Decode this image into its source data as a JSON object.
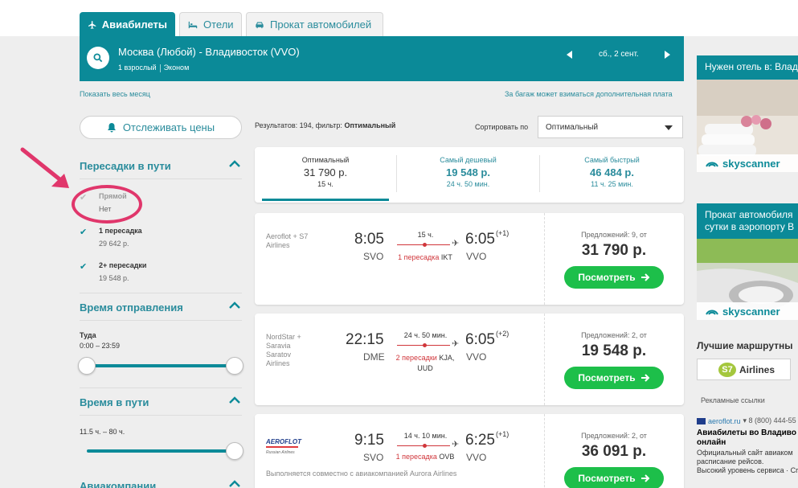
{
  "tabs": [
    {
      "label": "Авиабилеты",
      "icon": "plane-icon",
      "active": true
    },
    {
      "label": "Отели",
      "icon": "bed-icon",
      "active": false
    },
    {
      "label": "Прокат автомобилей",
      "icon": "car-icon",
      "active": false
    }
  ],
  "search": {
    "route": "Москва (Любой) - Владивосток (VVO)",
    "passengers": "1 взрослый",
    "cabin": "Эконом",
    "date": "сб., 2 сент."
  },
  "links": {
    "show_month": "Показать весь месяц",
    "baggage_fee": "За багаж может взиматься дополнительная плата"
  },
  "track_prices": "Отслеживать цены",
  "filters": {
    "stops_title": "Пересадки в пути",
    "stops": [
      {
        "label": "Прямой",
        "sub": "Нет",
        "checked": true,
        "disabled": true
      },
      {
        "label": "1 пересадка",
        "sub": "29 642 р.",
        "checked": true,
        "disabled": false
      },
      {
        "label": "2+ пересадки",
        "sub": "19 548 р.",
        "checked": true,
        "disabled": false
      }
    ],
    "departure_title": "Время отправления",
    "departure_label": "Туда",
    "departure_range": "0:00 – 23:59",
    "duration_title": "Время в пути",
    "duration_range": "11.5 ч. – 80 ч.",
    "airlines_title": "Авиакомпании"
  },
  "results": {
    "count_label": "Результатов: 194, фильтр:",
    "filter_name": "Оптимальный",
    "sort_label": "Сортировать по",
    "sort_value": "Оптимальный"
  },
  "sort_tabs": [
    {
      "title": "Оптимальный",
      "price": "31 790 р.",
      "duration": "15 ч."
    },
    {
      "title": "Самый дешевый",
      "price": "19 548 р.",
      "duration": "24 ч. 50 мин."
    },
    {
      "title": "Самый быстрый",
      "price": "46 484 р.",
      "duration": "11 ч. 25 мин."
    }
  ],
  "flights": [
    {
      "carrier": [
        "Aeroflot + S7",
        "Airlines"
      ],
      "dep_time": "8:05",
      "dep_airport": "SVO",
      "arr_time": "6:05",
      "arr_plus": "(+1)",
      "arr_airport": "VVO",
      "duration": "15 ч.",
      "stops_text": "1 пересадка",
      "stops_airports": "IKT",
      "offers": "Предложений: 9, от",
      "price": "31 790 р.",
      "button": "Посмотреть"
    },
    {
      "carrier": [
        "NordStar +",
        "Saravia",
        "Saratov",
        "Airlines"
      ],
      "dep_time": "22:15",
      "dep_airport": "DME",
      "arr_time": "6:05",
      "arr_plus": "(+2)",
      "arr_airport": "VVO",
      "duration": "24 ч. 50 мин.",
      "stops_text": "2 пересадки",
      "stops_airports": "KJA,",
      "stops_airports2": "UUD",
      "offers": "Предложений: 2, от",
      "price": "19 548 р.",
      "button": "Посмотреть"
    },
    {
      "carrier_logo": "AEROFLOT",
      "carrier_logo_sub": "Russian Airlines",
      "dep_time": "9:15",
      "dep_airport": "SVO",
      "arr_time": "6:25",
      "arr_plus": "(+1)",
      "arr_airport": "VVO",
      "duration": "14 ч. 10 мин.",
      "stops_text": "1 пересадка",
      "stops_airports": "OVB",
      "note": "Выполняется совместно с авиакомпанией Aurora Airlines",
      "offers": "Предложений: 2, от",
      "price": "36 091 р.",
      "button": "Посмотреть"
    }
  ],
  "sidebar_right": {
    "hotel_ad": "Нужен отель в: Влад",
    "car_ad_line1": "Прокат автомобиля",
    "car_ad_line2": "сутки в аэропорту В",
    "skyscanner": "skyscanner",
    "best_routes": "Лучшие маршрутны",
    "s7_logo": "S7",
    "s7_name": "Airlines",
    "ads_label": "Рекламные ссылки",
    "ad_url": "aeroflot.ru",
    "ad_phone": "▾ 8 (800) 444-55",
    "ad_title1": "Авиабилеты во Владиво",
    "ad_title2": "онлайн",
    "ad_text1": "Официальный сайт авиаком",
    "ad_text2": "расписание рейсов.",
    "ad_text3": "Высокий уровень сервиса · Сп"
  },
  "colors": {
    "accent": "#0b8a98",
    "button_green": "#1dbf4a",
    "stops_red": "#d0363b",
    "highlight_magenta": "#e0366b"
  }
}
